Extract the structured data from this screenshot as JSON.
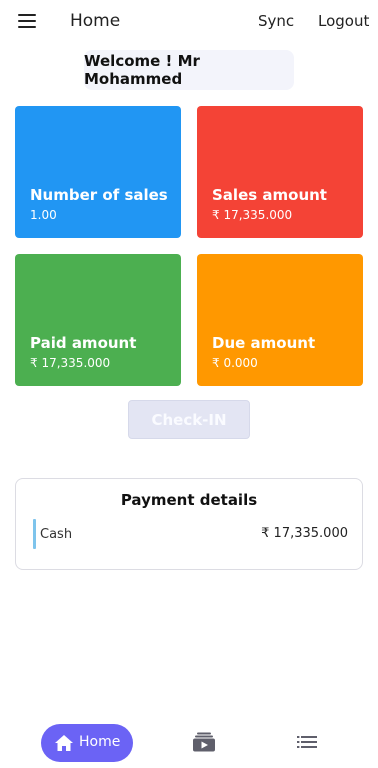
{
  "appbar": {
    "title": "Home",
    "sync_label": "Sync",
    "logout_label": "Logout",
    "menu_icon": "hamburger-menu-icon"
  },
  "welcome_text": "Welcome ! Mr Mohammed",
  "cards": [
    {
      "label": "Number of sales",
      "value": "1.00",
      "color": "#2196f3"
    },
    {
      "label": "Sales amount",
      "value": "₹ 17,335.000",
      "color": "#f44336"
    },
    {
      "label": "Paid amount",
      "value": "₹ 17,335.000",
      "color": "#4caf50"
    },
    {
      "label": "Due amount",
      "value": "₹ 0.000",
      "color": "#ff9800"
    }
  ],
  "checkin_label": "Check-IN",
  "payment": {
    "title": "Payment details",
    "rows": [
      {
        "method": "Cash",
        "amount": "₹ 17,335.000"
      }
    ]
  },
  "bottom_nav": {
    "home_label": "Home",
    "accent": "#6b63f5",
    "icons": [
      "home-icon",
      "media-library-icon",
      "list-icon"
    ]
  }
}
